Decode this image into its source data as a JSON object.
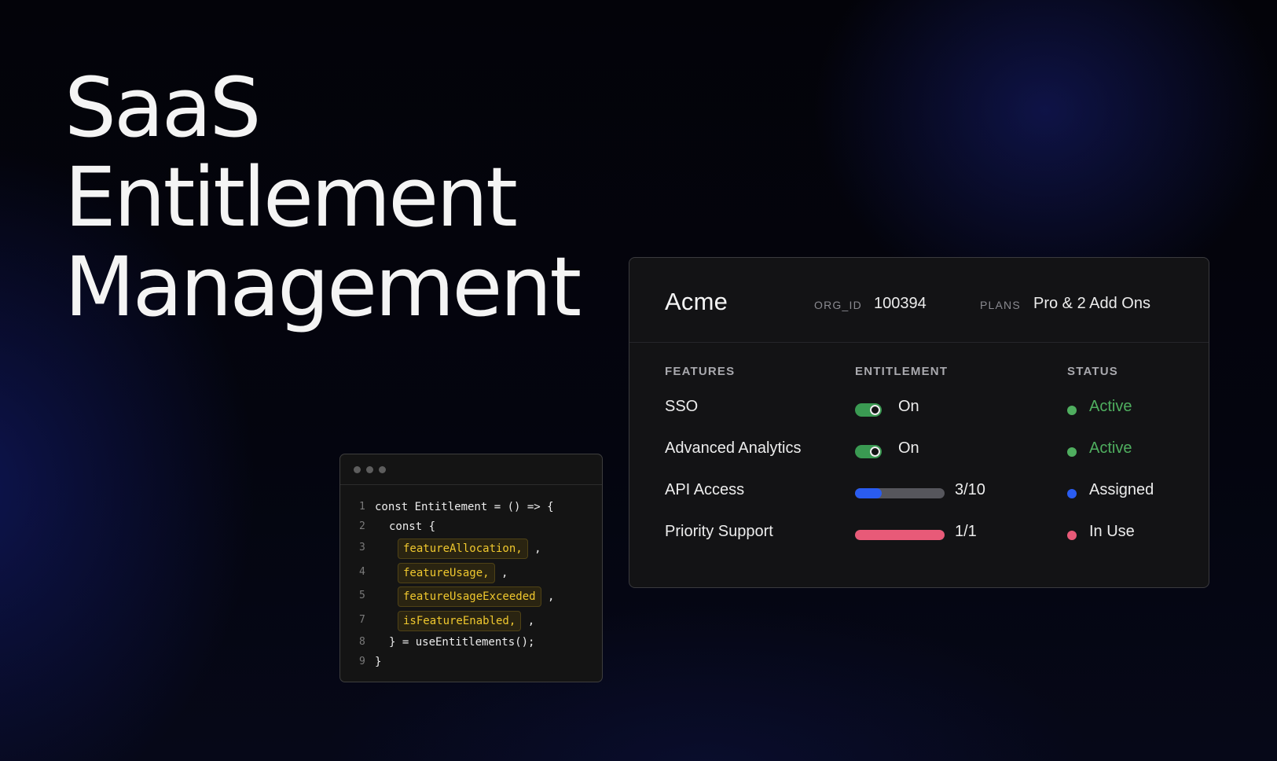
{
  "hero": {
    "line1": "SaaS",
    "line2": "Entitlement",
    "line3": "Management"
  },
  "card": {
    "org_name": "Acme",
    "org_id_label": "ORG_ID",
    "org_id_value": "100394",
    "plans_label": "PLANS",
    "plans_value": "Pro & 2 Add Ons",
    "columns": {
      "features": "FEATURES",
      "entitlement": "ENTITLEMENT",
      "status": "STATUS"
    },
    "rows": [
      {
        "feature": "SSO",
        "entitlement_type": "toggle",
        "entitlement_text": "On",
        "toggle_on": true,
        "status": "Active",
        "status_color": "#4fae5f"
      },
      {
        "feature": "Advanced Analytics",
        "entitlement_type": "toggle",
        "entitlement_text": "On",
        "toggle_on": true,
        "status": "Active",
        "status_color": "#4fae5f"
      },
      {
        "feature": "API Access",
        "entitlement_type": "usage",
        "entitlement_text": "3/10",
        "usage_fraction": 0.3,
        "bar_color": "#2a5cf0",
        "status": "Assigned",
        "status_color": "#2a5cf0"
      },
      {
        "feature": "Priority Support",
        "entitlement_type": "usage",
        "entitlement_text": "1/1",
        "usage_fraction": 1.0,
        "bar_color": "#e85a78",
        "status": "In Use",
        "status_color": "#e85a78"
      }
    ]
  },
  "code": {
    "window_dots": [
      "window-dot",
      "window-dot",
      "window-dot"
    ],
    "lines": [
      {
        "num": "1",
        "indent": 0,
        "text": "const Entitlement = () => {"
      },
      {
        "num": "2",
        "indent": 1,
        "text": "const {"
      },
      {
        "num": "3",
        "indent": 2,
        "chip": "featureAllocation,",
        "after": ","
      },
      {
        "num": "4",
        "indent": 2,
        "chip": "featureUsage,",
        "after": ","
      },
      {
        "num": "5",
        "indent": 2,
        "chip": "featureUsageExceeded",
        "after": ","
      },
      {
        "num": "7",
        "indent": 2,
        "chip": "isFeatureEnabled,",
        "after": ","
      },
      {
        "num": "8",
        "indent": 1,
        "text": "} = useEntitlements();"
      },
      {
        "num": "9",
        "indent": 0,
        "text": "}"
      }
    ]
  },
  "colors": {
    "background": "#04050f",
    "card_bg": "#131315",
    "toggle_on": "#3a9a52",
    "chip_text": "#f0c82e",
    "chip_bg": "#2a2411"
  }
}
